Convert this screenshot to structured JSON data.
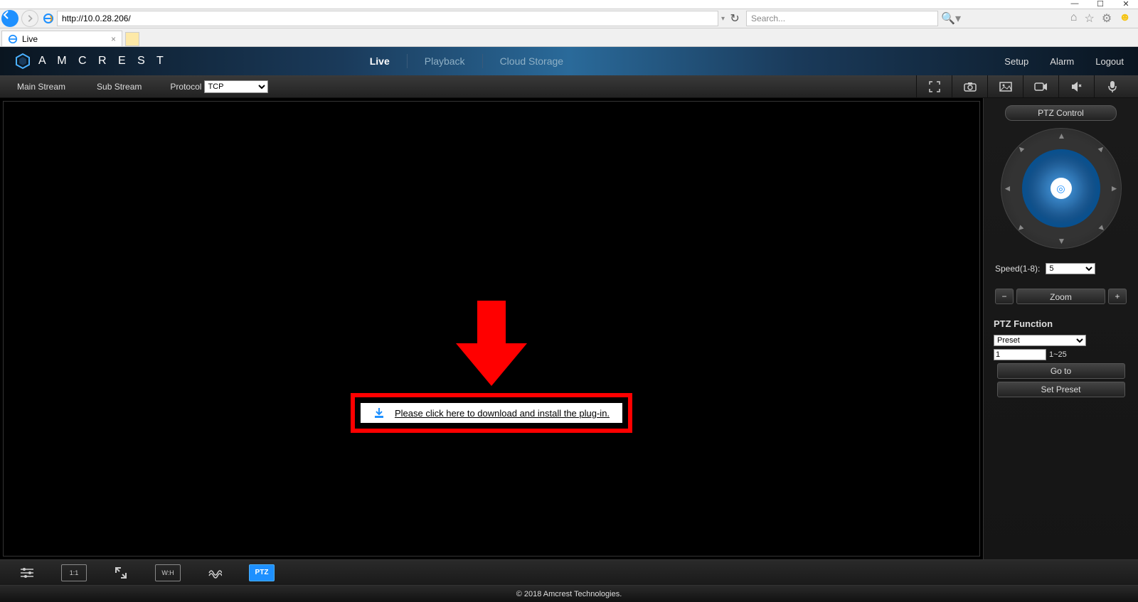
{
  "browser": {
    "url": "http://10.0.28.206/",
    "search_placeholder": "Search...",
    "tab_title": "Live"
  },
  "header": {
    "brand": "A M C R E S T",
    "tabs": {
      "live": "Live",
      "playback": "Playback",
      "cloud": "Cloud Storage"
    },
    "right": {
      "setup": "Setup",
      "alarm": "Alarm",
      "logout": "Logout"
    }
  },
  "subtoolbar": {
    "main_stream": "Main Stream",
    "sub_stream": "Sub Stream",
    "protocol_label": "Protocol",
    "protocol_value": "TCP"
  },
  "download": {
    "text": "Please click here to download and install the plug-in."
  },
  "ptz": {
    "title": "PTZ Control",
    "speed_label": "Speed(1-8):",
    "speed_value": "5",
    "zoom_label": "Zoom",
    "function_title": "PTZ Function",
    "function_value": "Preset",
    "preset_number": "1",
    "preset_range": "1~25",
    "goto": "Go to",
    "set_preset": "Set Preset"
  },
  "bottom": {
    "ptz_label": "PTZ",
    "ratio_11": "1:1",
    "wh": "W:H"
  },
  "footer": "© 2018 Amcrest Technologies."
}
